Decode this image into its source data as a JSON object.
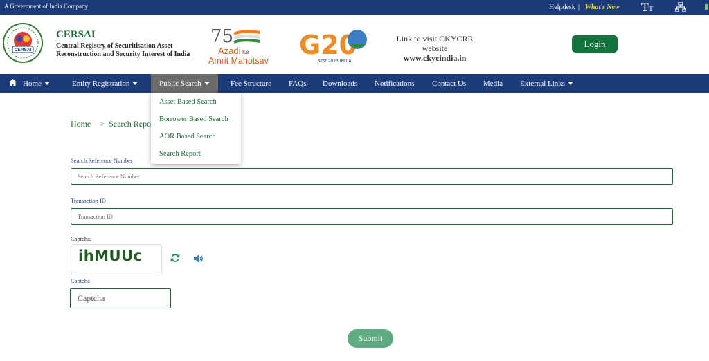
{
  "topbar": {
    "government": "A Government of India Company",
    "helpdesk": "Helpdesk",
    "separator": "|",
    "whats_new": "What's New",
    "text_size_big": "T",
    "text_size_small": "T"
  },
  "header": {
    "org_short": "CERSAI",
    "org_full": "Central Registry of Securitisation Asset Reconstruction and Security Interest of India",
    "logo_text": "CERSAI",
    "azadi": {
      "number": "75",
      "line1": "Azadi",
      "ka": "Ka",
      "line2": "Amrit Mahotsav"
    },
    "g20": {
      "text": "G20",
      "tagline": "भारत 2023 INDIA"
    },
    "ckycrr_link": "Link to visit CKYCRR website",
    "ckycrr_url": "www.ckycindia.in",
    "login_label": "Login"
  },
  "nav": {
    "items": [
      {
        "label": "Home"
      },
      {
        "label": "Entity Registration"
      },
      {
        "label": "Public Search"
      },
      {
        "label": "Fee Structure"
      },
      {
        "label": "FAQs"
      },
      {
        "label": "Downloads"
      },
      {
        "label": "Notifications"
      },
      {
        "label": "Contact Us"
      },
      {
        "label": "Media"
      },
      {
        "label": "External Links"
      }
    ],
    "dropdown": [
      {
        "label": "Asset Based Search"
      },
      {
        "label": "Borrower Based Search"
      },
      {
        "label": "AOR Based Search"
      },
      {
        "label": "Search Report"
      }
    ]
  },
  "breadcrumb": {
    "home": "Home",
    "arrow": ">",
    "current": "Search Report"
  },
  "form": {
    "ref_label": "Search Reference Number",
    "ref_placeholder": "Search Reference Number",
    "txn_label": "Transaction ID",
    "txn_placeholder": "Transaction ID",
    "captcha_heading": "Captcha:",
    "captcha_code": "ihMUUc",
    "captcha_label": "Captcha",
    "captcha_placeholder": "Captcha",
    "submit_label": "Submit"
  },
  "colors": {
    "navy": "#1c3b7a",
    "green": "#12733c",
    "submit_green": "#5fac83",
    "whats_new": "#f5e13c",
    "active_tab": "#6b6b6b"
  }
}
